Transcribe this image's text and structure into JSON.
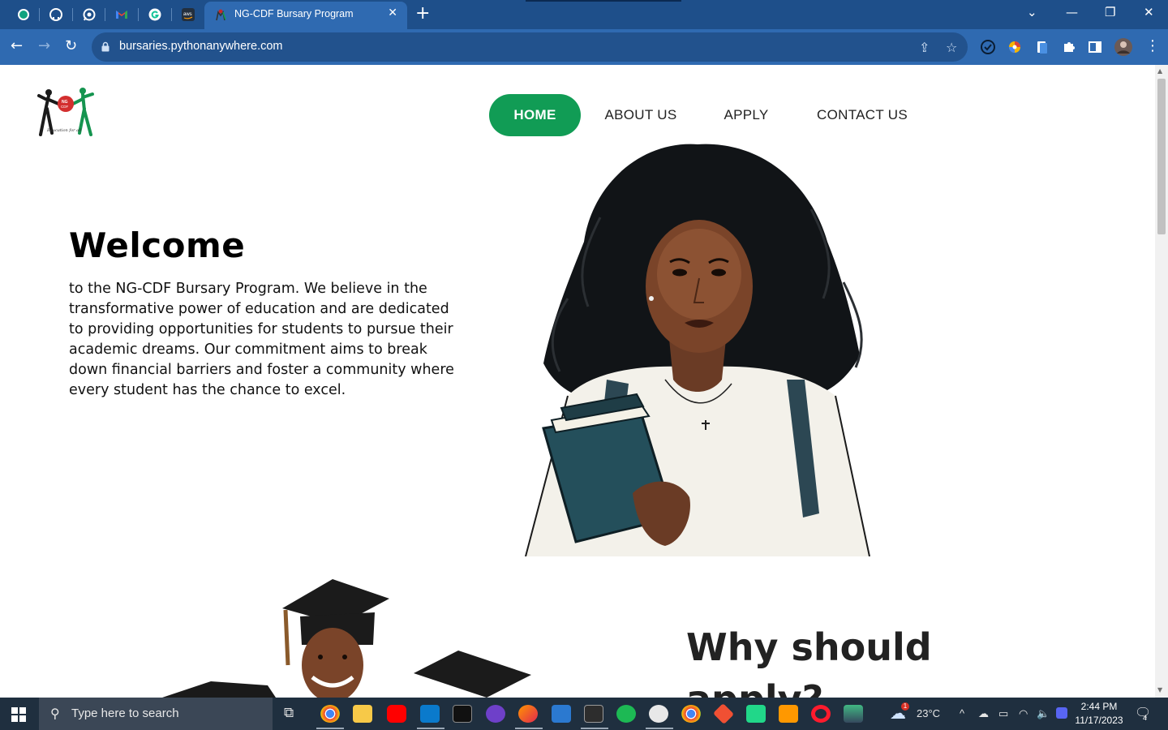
{
  "browser": {
    "active_tab_title": "NG-CDF Bursary Program",
    "tab_close": "✕",
    "new_tab": "+",
    "url": "bursaries.pythonanywhere.com",
    "pinned_tabs": [
      "chatgpt-icon",
      "github-icon",
      "whatsapp-icon",
      "gmail-icon",
      "grammarly-icon",
      "aws-icon"
    ],
    "extensions": [
      "todo-check-icon",
      "color-picker-icon",
      "clipboard-icon",
      "extensions-puzzle-icon",
      "side-panel-icon",
      "profile-avatar",
      "menu-dots-icon"
    ]
  },
  "site": {
    "nav": [
      {
        "label": "HOME",
        "active": true
      },
      {
        "label": "ABOUT US",
        "active": false
      },
      {
        "label": "APPLY",
        "active": false
      },
      {
        "label": "CONTACT US",
        "active": false
      }
    ],
    "welcome": {
      "title": "Welcome",
      "text": "to the NG-CDF Bursary Program. We believe in the transformative power of education and are dedicated to providing opportunities for students to pursue their academic dreams. Our commitment aims to break down financial barriers and foster a community where every student has the chance to excel."
    },
    "why_title": "Why should apply?",
    "logo_caption": "Education for all",
    "accent_color": "#119c55"
  },
  "taskbar": {
    "search_placeholder": "Type here to search",
    "weather": "23°C",
    "weather_badge": "1",
    "time": "2:44 PM",
    "date": "11/17/2023",
    "notifications": "4"
  }
}
